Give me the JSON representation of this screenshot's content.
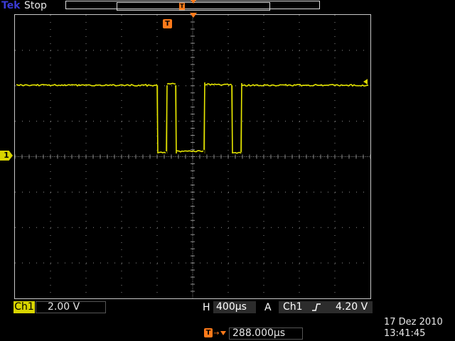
{
  "header": {
    "brand": "Tek",
    "run_state": "Stop"
  },
  "channel": {
    "name": "Ch1",
    "scale": "2.00 V",
    "marker": "1"
  },
  "horizontal": {
    "label": "H",
    "value": "400µs"
  },
  "trigger": {
    "label": "A",
    "source": "Ch1",
    "slope_icon": "rising-edge-icon",
    "level": "4.20 V",
    "marker": "T",
    "position": "288.000µs"
  },
  "timestamp": {
    "date": "17 Dez  2010",
    "time": "13:41:45"
  },
  "colors": {
    "trace": "#e6e600",
    "trigger": "#ff7a1a",
    "grid": "#8c8c8c",
    "background": "#000000"
  }
}
